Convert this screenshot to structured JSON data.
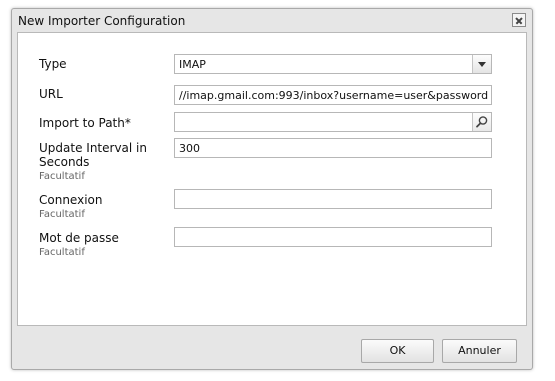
{
  "dialog": {
    "title": "New Importer Configuration"
  },
  "form": {
    "type": {
      "label": "Type",
      "value": "IMAP"
    },
    "url": {
      "label": "URL",
      "value": "//imap.gmail.com:993/inbox?username=user&password=s"
    },
    "import_path": {
      "label": "Import to Path*",
      "value": ""
    },
    "interval": {
      "label_line1": "Update Interval in",
      "label_line2": "Seconds",
      "hint": "Facultatif",
      "value": "300"
    },
    "connexion": {
      "label": "Connexion",
      "hint": "Facultatif",
      "value": ""
    },
    "password": {
      "label": "Mot de passe",
      "hint": "Facultatif",
      "value": ""
    }
  },
  "buttons": {
    "ok": "OK",
    "cancel": "Annuler"
  },
  "icons": {
    "close": "close-icon",
    "dropdown": "chevron-down-icon",
    "search": "search-icon"
  }
}
